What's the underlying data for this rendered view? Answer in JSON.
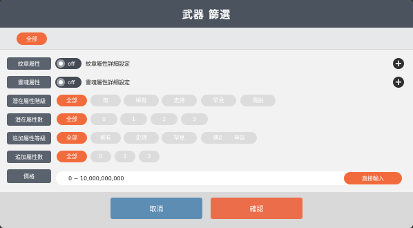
{
  "title": "武器 篩選",
  "top_filter": {
    "label": "全部"
  },
  "rows": {
    "emblem": {
      "label": "紋章屬性",
      "toggle": "off",
      "detail": "紋章屬性詳細設定"
    },
    "soul": {
      "label": "靈魂屬性",
      "toggle": "off",
      "detail": "靈魂屬性詳細設定"
    },
    "potential_grade": {
      "label": "潛在屬性階級",
      "options": [
        "全部",
        "無",
        "稀有",
        "史詩",
        "罕見",
        "傳說"
      ]
    },
    "potential_count": {
      "label": "潛在屬性數",
      "options": [
        "全部",
        "0",
        "1",
        "2",
        "3"
      ]
    },
    "additional_grade": {
      "label": "追加屬性等級",
      "options": [
        "全部",
        "稀有",
        "史詩",
        "罕見",
        "傳說",
        "神話"
      ]
    },
    "additional_count": {
      "label": "追加屬性數",
      "options": [
        "全部",
        "0",
        "1",
        "2"
      ]
    },
    "price": {
      "label": "價格",
      "range": "0 ~ 10,000,000,000",
      "direct_input": "直接輸入"
    }
  },
  "buttons": {
    "cancel": "取消",
    "confirm": "確認"
  },
  "colors": {
    "accent": "#f26b3d",
    "header": "#4a535e",
    "cancel": "#5e8db3",
    "confirm": "#ec6d4a"
  },
  "icons": {
    "add": "plus-icon"
  }
}
